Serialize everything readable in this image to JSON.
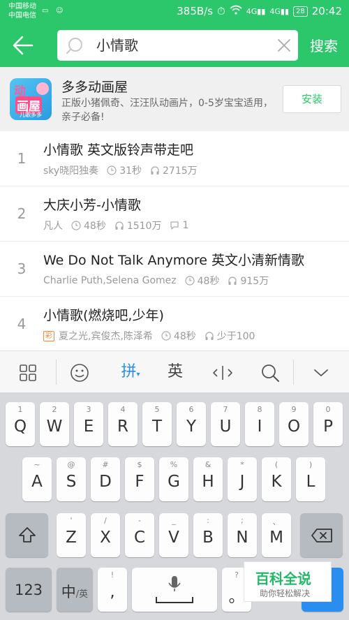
{
  "status_bar": {
    "carrier_1": "中国移动",
    "carrier_2": "中国电信",
    "speed": "385B/s",
    "battery": "28",
    "time": "20:42",
    "signal_1": "4G",
    "signal_2": "4G"
  },
  "search": {
    "query": "小情歌",
    "search_button": "搜索"
  },
  "ad": {
    "logo_text_1": "动",
    "logo_text_2": "画屋",
    "logo_sub": "儿歌多多",
    "title": "多多动画屋",
    "description": "正版小猪佩奇、汪汪队动画片，0-5岁宝宝适用，亲子必备!",
    "install_label": "安装"
  },
  "results": [
    {
      "index": "1",
      "title": "小情歌 英文版铃声带走吧",
      "artist": "sky晓阳独奏",
      "duration": "31秒",
      "plays": "2715万"
    },
    {
      "index": "2",
      "title": "大庆小芳-小情歌",
      "artist": "凡人",
      "duration": "48秒",
      "plays": "1510万",
      "comments": "1"
    },
    {
      "index": "3",
      "title": "We Do Not Talk Anymore  英文小清新情歌",
      "artist": "Charlie Puth,Selena Gomez",
      "duration": "48秒",
      "plays": "915万"
    },
    {
      "index": "4",
      "title": "小情歌(燃烧吧,少年)",
      "tag": "彩",
      "artist": "夏之光,宾俊杰,陈泽希",
      "duration": "48秒",
      "plays": "少于100"
    }
  ],
  "keyboard_toolbar": {
    "pinyin_label": "拼",
    "english_label": "英"
  },
  "keyboard": {
    "row1": [
      {
        "main": "Q",
        "sub": "1"
      },
      {
        "main": "W",
        "sub": "2"
      },
      {
        "main": "E",
        "sub": "3"
      },
      {
        "main": "R",
        "sub": "4"
      },
      {
        "main": "T",
        "sub": "5"
      },
      {
        "main": "Y",
        "sub": "6"
      },
      {
        "main": "U",
        "sub": "7"
      },
      {
        "main": "I",
        "sub": "8"
      },
      {
        "main": "O",
        "sub": "9"
      },
      {
        "main": "P",
        "sub": "0"
      }
    ],
    "row2": [
      {
        "main": "A",
        "sub": "~"
      },
      {
        "main": "S",
        "sub": "@"
      },
      {
        "main": "D",
        "sub": "#"
      },
      {
        "main": "F",
        "sub": "$"
      },
      {
        "main": "G",
        "sub": "%"
      },
      {
        "main": "H",
        "sub": "&"
      },
      {
        "main": "J",
        "sub": "*"
      },
      {
        "main": "K",
        "sub": "("
      },
      {
        "main": "L",
        "sub": ")"
      }
    ],
    "row3": [
      {
        "main": "Z",
        "sub": "'"
      },
      {
        "main": "X",
        "sub": "/"
      },
      {
        "main": "C",
        "sub": "-"
      },
      {
        "main": "V",
        "sub": "_"
      },
      {
        "main": "B",
        "sub": ":"
      },
      {
        "main": "N",
        "sub": ";"
      },
      {
        "main": "M",
        "sub": "、"
      }
    ],
    "num_key": "123",
    "lang_key_main": "中",
    "lang_key_sub": "/英",
    "comma_key": ",",
    "comma_sub": "!",
    "period_key": "。",
    "period_sub": "?"
  },
  "watermark": {
    "title": "百科全说",
    "subtitle": "助你轻松解决"
  },
  "colors": {
    "accent": "#2cc76a",
    "keyboard_bg": "#d6d8dc",
    "toolbar_accent": "#2a8ef0"
  }
}
